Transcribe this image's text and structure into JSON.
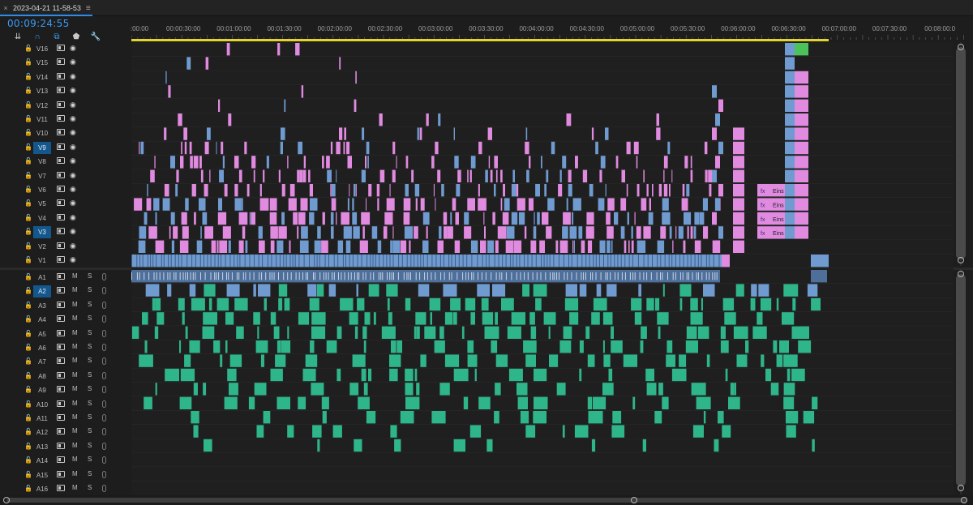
{
  "sequence_tab": {
    "close": "×",
    "name": "2023-04-21 11-58-53",
    "menu": "≡"
  },
  "timecode": "00:09:24:55",
  "tools": [
    {
      "name": "snap-settings-icon",
      "glyph": "⇊"
    },
    {
      "name": "magnet-snap-icon",
      "glyph": "∩"
    },
    {
      "name": "linked-selection-icon",
      "glyph": "⧉"
    },
    {
      "name": "add-marker-icon",
      "glyph": "⬟"
    },
    {
      "name": "wrench-icon",
      "glyph": "🔧"
    }
  ],
  "ruler_labels": [
    ":00:00",
    "00:00:30:00",
    "00:01:00:00",
    "00:01:30:00",
    "00:02:00:00",
    "00:02:30:00",
    "00:03:00:00",
    "00:03:30:00",
    "00:04:00:00",
    "00:04:30:00",
    "00:05:00:00",
    "00:05:30:00",
    "00:06:00:00",
    "00:06:30:00",
    "00:07:00:00",
    "00:07:30:00",
    "00:08:00:0"
  ],
  "video_tracks": [
    {
      "label": "V16",
      "selected": false
    },
    {
      "label": "V15",
      "selected": false
    },
    {
      "label": "V14",
      "selected": false
    },
    {
      "label": "V13",
      "selected": false
    },
    {
      "label": "V12",
      "selected": false
    },
    {
      "label": "V11",
      "selected": false
    },
    {
      "label": "V10",
      "selected": false
    },
    {
      "label": "V9",
      "selected": true
    },
    {
      "label": "V8",
      "selected": false
    },
    {
      "label": "V7",
      "selected": false
    },
    {
      "label": "V6",
      "selected": false
    },
    {
      "label": "V5",
      "selected": false
    },
    {
      "label": "V4",
      "selected": false
    },
    {
      "label": "V3",
      "selected": true
    },
    {
      "label": "V2",
      "selected": false
    },
    {
      "label": "V1",
      "selected": false
    }
  ],
  "audio_tracks": [
    {
      "label": "A1",
      "selected": false
    },
    {
      "label": "A2",
      "selected": true
    },
    {
      "label": "A3",
      "selected": false
    },
    {
      "label": "A4",
      "selected": false
    },
    {
      "label": "A5",
      "selected": false
    },
    {
      "label": "A6",
      "selected": false
    },
    {
      "label": "A7",
      "selected": false
    },
    {
      "label": "A8",
      "selected": false
    },
    {
      "label": "A9",
      "selected": false
    },
    {
      "label": "A10",
      "selected": false
    },
    {
      "label": "A11",
      "selected": false
    },
    {
      "label": "A12",
      "selected": false
    },
    {
      "label": "A13",
      "selected": false
    },
    {
      "label": "A14",
      "selected": false
    },
    {
      "label": "A15",
      "selected": false
    },
    {
      "label": "A16",
      "selected": false
    }
  ],
  "audio_buttons": {
    "mute": "M",
    "solo": "S"
  },
  "title_clips": [
    {
      "track": "V6",
      "fx": "fx",
      "text": "Eins"
    },
    {
      "track": "V5",
      "fx": "fx",
      "text": "Eins"
    },
    {
      "track": "V4",
      "fx": "fx",
      "text": "Eins"
    },
    {
      "track": "V3",
      "fx": "fx",
      "text": "Eins"
    }
  ],
  "colors": {
    "accent_blue": "#2d8ceb",
    "clip_pink": "#e08ae0",
    "clip_blue": "#6f9bd1",
    "clip_audio": "#2fb58a",
    "clip_green": "#4cc25a",
    "render_yellow": "#e3d52e"
  }
}
